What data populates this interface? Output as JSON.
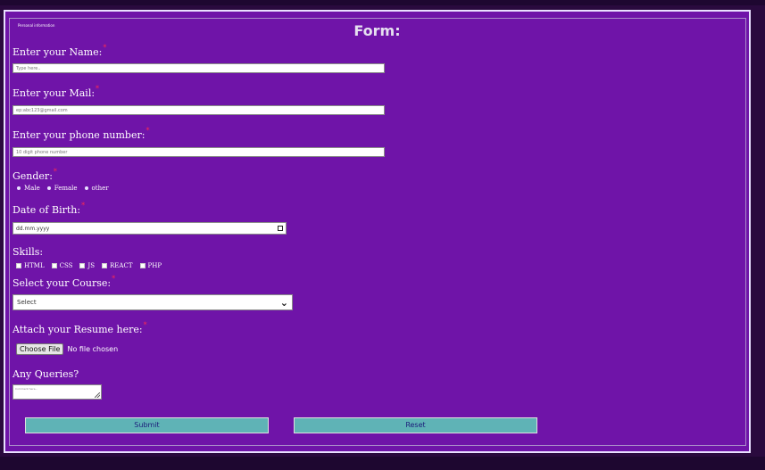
{
  "form": {
    "legend": "Personal information",
    "title": "Form:",
    "required_mark": "*",
    "name": {
      "label": "Enter your Name:",
      "placeholder": "Type here.."
    },
    "mail": {
      "label": "Enter your Mail:",
      "placeholder": "ep:abc123@gmail.com"
    },
    "phone": {
      "label": "Enter your phone number:",
      "placeholder": "10 digit phone number"
    },
    "gender": {
      "label": "Gender:",
      "options": [
        "Male",
        "Female",
        "other"
      ]
    },
    "dob": {
      "label": "Date of Birth:",
      "placeholder": "dd.mm.yyyy"
    },
    "skills": {
      "label": "Skills:",
      "options": [
        "HTML",
        "CSS",
        "JS",
        "REACT",
        "PHP"
      ]
    },
    "course": {
      "label": "Select your Course:",
      "selected": "Select"
    },
    "resume": {
      "label": "Attach your Resume here:",
      "button": "Choose File",
      "status": "No file chosen"
    },
    "queries": {
      "label": "Any Queries?",
      "placeholder": "Comment here..."
    },
    "submit_label": "Submit",
    "reset_label": "Reset"
  },
  "icons": {
    "calendar": "calendar-icon",
    "chevron": "chevron-down-icon",
    "resize": "resize-grip-icon"
  },
  "colors": {
    "background": "#2a0a3e",
    "form_background": "#6f14a8",
    "button": "#5fb3b6",
    "required": "#ff2a4f"
  }
}
